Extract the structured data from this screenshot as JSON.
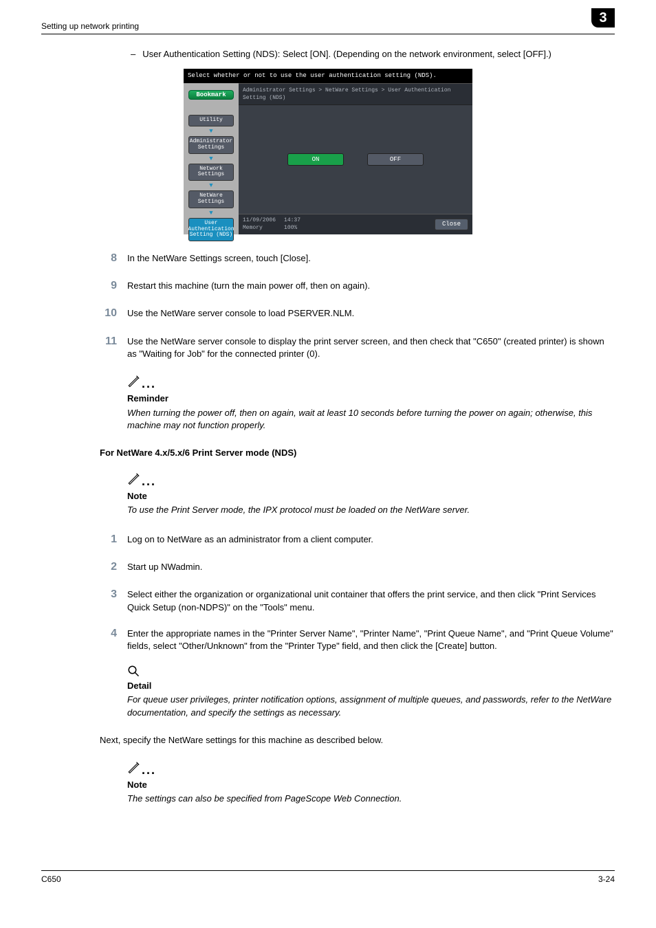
{
  "header": {
    "title": "Setting up network printing",
    "chapter": "3"
  },
  "intro": {
    "bullet": "User Authentication Setting (NDS): Select [ON]. (Depending on the network environment, select [OFF].)"
  },
  "panel": {
    "description": "Select whether or not to use the user authentication setting (NDS).",
    "bookmark": "Bookmark",
    "nav": {
      "utility": "Utility",
      "admin": "Administrator Settings",
      "network": "Network Settings",
      "netware": "NetWare Settings",
      "userauth": "User Authentication Setting (NDS)"
    },
    "crumbs": "Administrator Settings > NetWare Settings > User Authentication Setting (NDS)",
    "on": "ON",
    "off": "OFF",
    "date": "11/09/2006",
    "time": "14:37",
    "mem_l": "Memory",
    "mem_v": "100%",
    "close": "Close"
  },
  "steps1": [
    {
      "n": "8",
      "t": "In the NetWare Settings screen, touch [Close]."
    },
    {
      "n": "9",
      "t": "Restart this machine (turn the main power off, then on again)."
    },
    {
      "n": "10",
      "t": "Use the NetWare server console to load PSERVER.NLM."
    },
    {
      "n": "11",
      "t": "Use the NetWare server console to display the print server screen, and then check that \"C650\" (created printer) is shown as \"Waiting for Job\" for the connected printer (0)."
    }
  ],
  "reminder": {
    "label": "Reminder",
    "body": "When turning the power off, then on again, wait at least 10 seconds before turning the power on again; otherwise, this machine may not function properly."
  },
  "section2": {
    "heading": "For NetWare 4.x/5.x/6 Print Server mode (NDS)"
  },
  "note1": {
    "label": "Note",
    "body": "To use the Print Server mode, the IPX protocol must be loaded on the NetWare server."
  },
  "steps2": [
    {
      "n": "1",
      "t": "Log on to NetWare as an administrator from a client computer."
    },
    {
      "n": "2",
      "t": "Start up NWadmin."
    },
    {
      "n": "3",
      "t": "Select either the organization or organizational unit container that offers the print service, and then click \"Print Services Quick Setup (non-NDPS)\" on the \"Tools\" menu."
    },
    {
      "n": "4",
      "t": "Enter the appropriate names in the \"Printer Server Name\", \"Printer Name\", \"Print Queue Name\", and \"Print Queue Volume\" fields, select \"Other/Unknown\" from the \"Printer Type\" field, and then click the [Create] button."
    }
  ],
  "detail": {
    "label": "Detail",
    "body": "For queue user privileges, printer notification options, assignment of multiple queues, and passwords, refer to the NetWare documentation, and specify the settings as necessary."
  },
  "para": "Next, specify the NetWare settings for this machine as described below.",
  "note2": {
    "label": "Note",
    "body": "The settings can also be specified from PageScope Web Connection."
  },
  "footer": {
    "model": "C650",
    "page": "3-24"
  }
}
